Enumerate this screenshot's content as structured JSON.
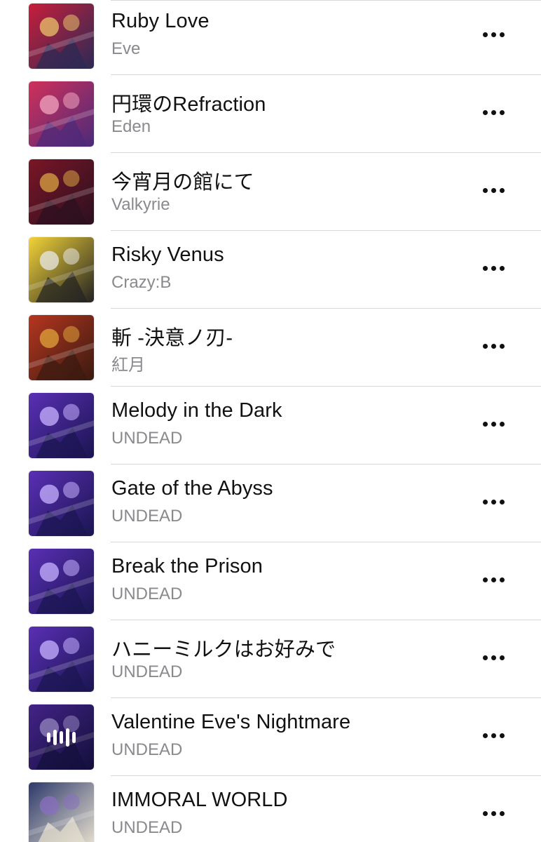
{
  "songs": [
    {
      "title": "Ruby Love",
      "artist": "Eve",
      "art": "ruby-love-cover-art",
      "palette": [
        "#c81e3a",
        "#2a2a55",
        "#e9c46a"
      ]
    },
    {
      "title": "円環のRefraction",
      "artist": "Eden",
      "art": "refraction-cover-art",
      "palette": [
        "#d0305a",
        "#4b2a7a",
        "#f2a5c0"
      ]
    },
    {
      "title": "今宵月の館にて",
      "artist": "Valkyrie",
      "art": "valkyrie-cover-art",
      "palette": [
        "#7a1626",
        "#2b1020",
        "#d9a441"
      ]
    },
    {
      "title": "Risky Venus",
      "artist": "Crazy:B",
      "art": "risky-venus-cover-art",
      "palette": [
        "#f2d338",
        "#222222",
        "#e8e8e8"
      ]
    },
    {
      "title": "斬 -決意ノ刃-",
      "artist": "紅月",
      "art": "kougetsu-cover-art",
      "palette": [
        "#b5361f",
        "#3a1a10",
        "#e0a43a"
      ]
    },
    {
      "title": "Melody in the Dark",
      "artist": "UNDEAD",
      "art": "undead-cover-art",
      "palette": [
        "#5a2fb5",
        "#1a1550",
        "#c7b3ff"
      ]
    },
    {
      "title": "Gate of the Abyss",
      "artist": "UNDEAD",
      "art": "undead-cover-art",
      "palette": [
        "#5a2fb5",
        "#1a1550",
        "#c7b3ff"
      ]
    },
    {
      "title": "Break the Prison",
      "artist": "UNDEAD",
      "art": "undead-cover-art",
      "palette": [
        "#5a2fb5",
        "#1a1550",
        "#c7b3ff"
      ]
    },
    {
      "title": "ハニーミルクはお好みで",
      "artist": "UNDEAD",
      "art": "undead-cover-art",
      "palette": [
        "#5a2fb5",
        "#1a1550",
        "#c7b3ff"
      ]
    },
    {
      "title": "Valentine Eve's Nightmare",
      "artist": "UNDEAD",
      "art": "undead-cover-art",
      "palette": [
        "#5a2fb5",
        "#1a1550",
        "#c7b3ff"
      ],
      "now_playing": true
    },
    {
      "title": "IMMORAL WORLD",
      "artist": "UNDEAD",
      "art": "immoral-world-cover-art",
      "palette": [
        "#2d3a6b",
        "#e9e2d0",
        "#8a6fc0"
      ]
    }
  ],
  "more_icon": "ellipsis-icon",
  "now_playing_icon": "audio-waveform-icon"
}
